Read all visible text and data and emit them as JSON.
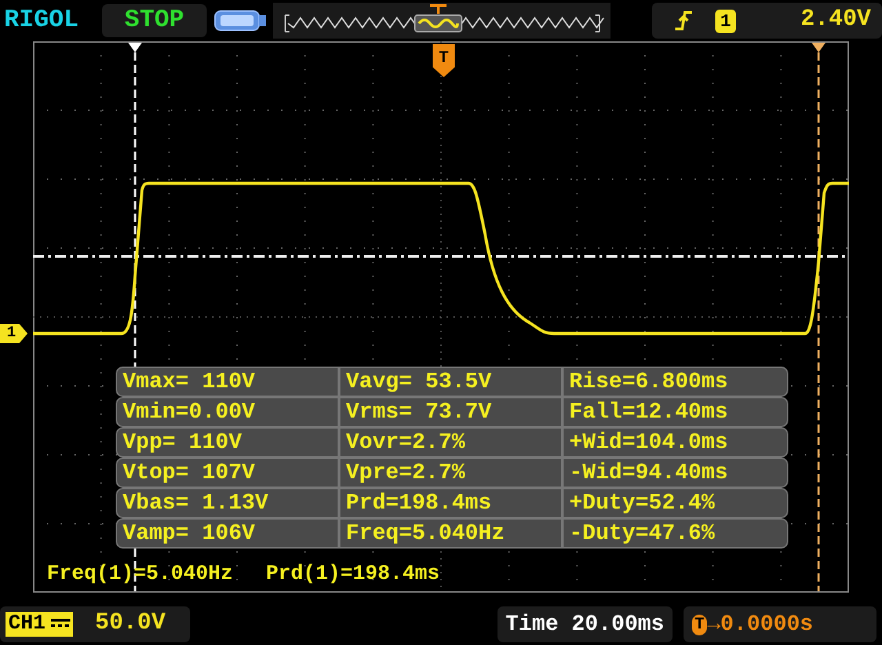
{
  "header": {
    "brand": "RIGOL",
    "run_state": "STOP",
    "trigger": {
      "channel": "1",
      "level": "2.40V"
    }
  },
  "screen": {
    "channel_marker": "1",
    "trigger_marker": "T",
    "measurements": [
      {
        "cells": [
          "Vmax= 110V",
          "Vavg= 53.5V",
          "Rise=6.800ms"
        ]
      },
      {
        "cells": [
          "Vmin=0.00V",
          "Vrms= 73.7V",
          "Fall=12.40ms"
        ]
      },
      {
        "cells": [
          "Vpp= 110V",
          "Vovr=2.7%",
          "+Wid=104.0ms"
        ]
      },
      {
        "cells": [
          "Vtop= 107V",
          "Vpre=2.7%",
          "-Wid=94.40ms"
        ]
      },
      {
        "cells": [
          "Vbas= 1.13V",
          "Prd=198.4ms",
          "+Duty=52.4%"
        ]
      },
      {
        "cells": [
          "Vamp= 106V",
          "Freq=5.040Hz",
          "-Duty=47.6%"
        ]
      }
    ],
    "readouts": [
      "Freq(1)=5.040Hz",
      "Prd(1)=198.4ms"
    ]
  },
  "footer": {
    "channel": "CH1",
    "scale": "50.0V",
    "timebase": "Time 20.00ms",
    "trigger_badge": "T",
    "trigger_offset": "→0.0000s"
  }
}
